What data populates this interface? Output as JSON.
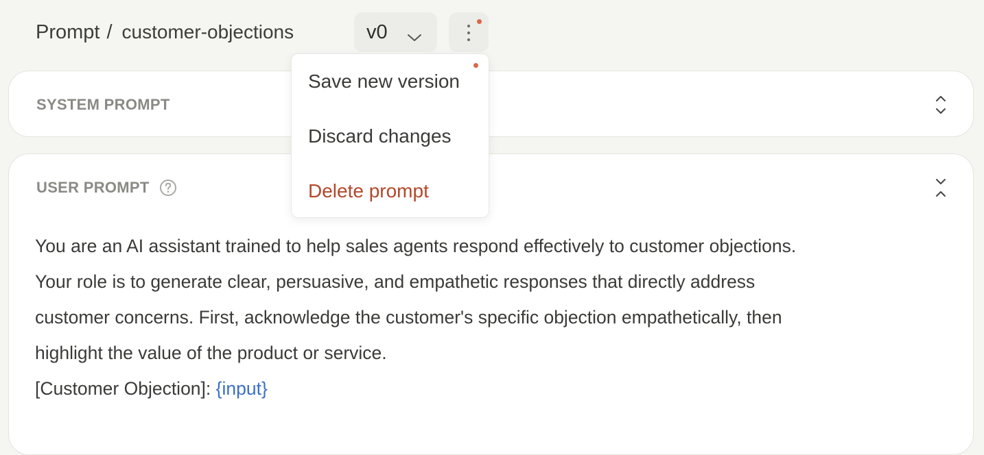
{
  "breadcrumb": {
    "root": "Prompt",
    "separator": "/",
    "current": "customer-objections"
  },
  "version_select": {
    "selected": "v0"
  },
  "more_menu": {
    "icon": "vertical-dots-icon",
    "has_unsaved_indicator": true,
    "items": [
      {
        "label": "Save new version",
        "has_indicator": true
      },
      {
        "label": "Discard changes"
      },
      {
        "label": "Delete prompt",
        "variant": "danger"
      }
    ]
  },
  "system_prompt": {
    "title": "SYSTEM PROMPT",
    "toggle_icon": "expand-icon"
  },
  "user_prompt": {
    "title": "USER PROMPT",
    "help_icon": "question-circle-icon",
    "toggle_icon": "collapse-icon",
    "lines": [
      "You are an AI assistant trained to help sales agents respond effectively to customer objections.",
      "Your role is to generate clear, persuasive, and empathetic responses that directly address",
      "customer concerns. First, acknowledge the customer's specific objection empathetically, then",
      "highlight the value of the product or service."
    ],
    "variable_label": "[Customer Objection]:",
    "variable_token": "{input}"
  },
  "colors": {
    "background": "#f5f5f2",
    "card": "#ffffff",
    "indicator": "#d9684a",
    "danger": "#b5472a",
    "variable": "#3b6fc9"
  }
}
